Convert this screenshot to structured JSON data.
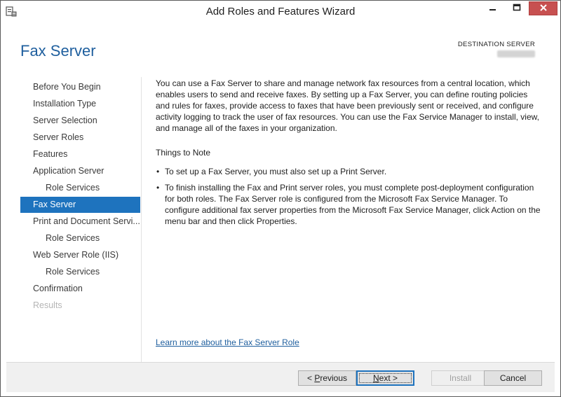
{
  "window": {
    "title": "Add Roles and Features Wizard",
    "controls": {
      "minimize": "minimize",
      "maximize": "maximize",
      "close": "close"
    }
  },
  "header": {
    "page_title": "Fax Server",
    "destination_label": "DESTINATION SERVER"
  },
  "nav": {
    "items": [
      {
        "label": "Before You Begin",
        "state": "normal",
        "sub": false
      },
      {
        "label": "Installation Type",
        "state": "normal",
        "sub": false
      },
      {
        "label": "Server Selection",
        "state": "normal",
        "sub": false
      },
      {
        "label": "Server Roles",
        "state": "normal",
        "sub": false
      },
      {
        "label": "Features",
        "state": "normal",
        "sub": false
      },
      {
        "label": "Application Server",
        "state": "normal",
        "sub": false
      },
      {
        "label": "Role Services",
        "state": "normal",
        "sub": true
      },
      {
        "label": "Fax Server",
        "state": "active",
        "sub": false
      },
      {
        "label": "Print and Document Servi...",
        "state": "normal",
        "sub": false
      },
      {
        "label": "Role Services",
        "state": "normal",
        "sub": true
      },
      {
        "label": "Web Server Role (IIS)",
        "state": "normal",
        "sub": false
      },
      {
        "label": "Role Services",
        "state": "normal",
        "sub": true
      },
      {
        "label": "Confirmation",
        "state": "normal",
        "sub": false
      },
      {
        "label": "Results",
        "state": "disabled",
        "sub": false
      }
    ]
  },
  "content": {
    "intro": "You can use a Fax Server to share and manage network fax resources from a central location, which enables users to send and receive faxes. By setting up a Fax Server, you can define routing policies and rules for faxes, provide access to faxes that have been previously sent or received, and configure activity logging to track the user of fax resources. You can use the Fax Service Manager to install, view, and manage all of the faxes in your organization.",
    "note_title": "Things to Note",
    "notes": [
      "To set up a Fax Server, you must also set up a Print Server.",
      "To finish installing the Fax and Print server roles, you must complete post-deployment configuration for both roles. The Fax Server role is configured from the Microsoft Fax Service Manager. To configure additional fax server properties from the Microsoft Fax Service Manager, click Action on the menu bar and then click Properties."
    ],
    "learn_more": "Learn more about the Fax Server Role"
  },
  "footer": {
    "previous": {
      "prefix": "< ",
      "accel": "P",
      "rest": "revious"
    },
    "next": {
      "accel": "N",
      "rest": "ext >"
    },
    "install": {
      "label": "Install",
      "enabled": false
    },
    "cancel": {
      "label": "Cancel"
    }
  },
  "colors": {
    "accent": "#1e73be",
    "title_blue": "#1f5f9e",
    "close_red": "#c75050",
    "footer_bg": "#f0f0f0"
  },
  "icons": [
    "server-manager-icon",
    "minimize-icon",
    "maximize-icon",
    "close-icon"
  ]
}
